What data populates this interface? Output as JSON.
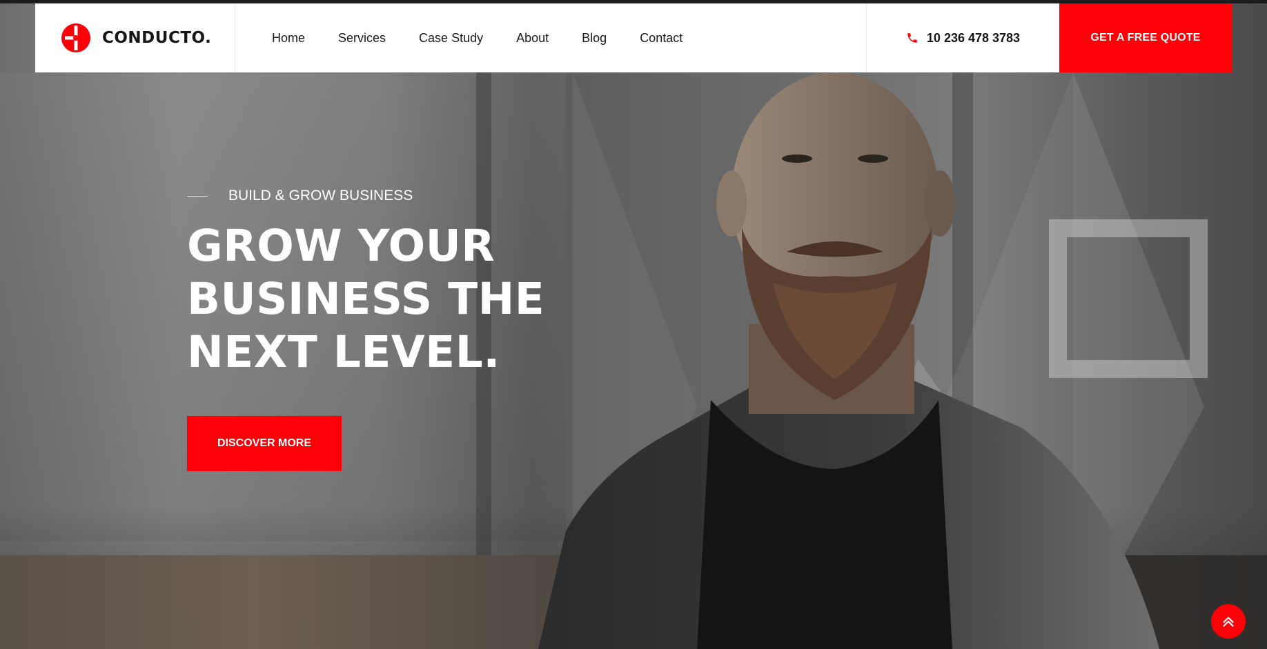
{
  "brand": {
    "name": "CONDUCTO."
  },
  "nav": {
    "items": [
      {
        "label": "Home"
      },
      {
        "label": "Services"
      },
      {
        "label": "Case Study"
      },
      {
        "label": "About"
      },
      {
        "label": "Blog"
      },
      {
        "label": "Contact"
      }
    ]
  },
  "contact": {
    "phone": "10 236 478 3783",
    "icon": "phone-icon"
  },
  "header_cta": {
    "label": "GET A FREE QUOTE"
  },
  "hero": {
    "eyebrow": "BUILD & GROW BUSINESS",
    "title": "GROW YOUR BUSINESS THE NEXT LEVEL.",
    "button": "DISCOVER MORE"
  },
  "scroll_top": {
    "icon": "double-chevron-up-icon"
  },
  "colors": {
    "accent": "#fb0007",
    "header_bg": "#ffffff",
    "text_dark": "#161616"
  }
}
